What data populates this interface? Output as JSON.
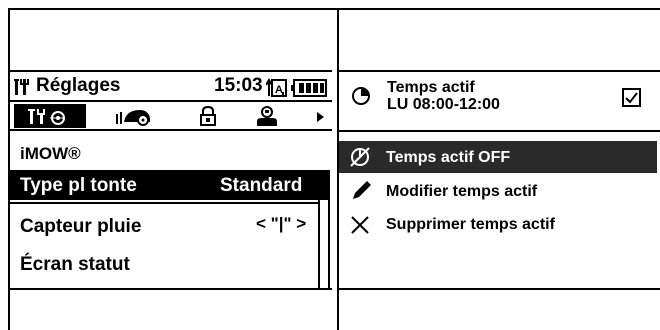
{
  "left": {
    "header": {
      "title": "Réglages",
      "time": "15:03"
    },
    "tabs": [
      "settings",
      "mower",
      "lock",
      "user"
    ],
    "menu_title": "iMOW®",
    "rows": [
      {
        "label": "Type pl tonte",
        "value": "Standard",
        "selected": true
      },
      {
        "label": "Capteur pluie",
        "value": "< \"|\" >",
        "selected": false
      },
      {
        "label": "Écran statut",
        "value": "",
        "selected": false
      }
    ]
  },
  "right": {
    "schedule": {
      "title": "Temps actif",
      "subtitle": "LU 08:00-12:00",
      "checked": true
    },
    "menu": [
      {
        "label": "Temps actif OFF",
        "icon": "timer-off-icon",
        "highlighted": true
      },
      {
        "label": "Modifier temps actif",
        "icon": "pencil-icon",
        "highlighted": false
      },
      {
        "label": "Supprimer temps actif",
        "icon": "x-icon",
        "highlighted": false
      }
    ]
  },
  "colors": {
    "text": "#000000",
    "background": "#ffffff",
    "highlight": "#2a2a2a"
  }
}
